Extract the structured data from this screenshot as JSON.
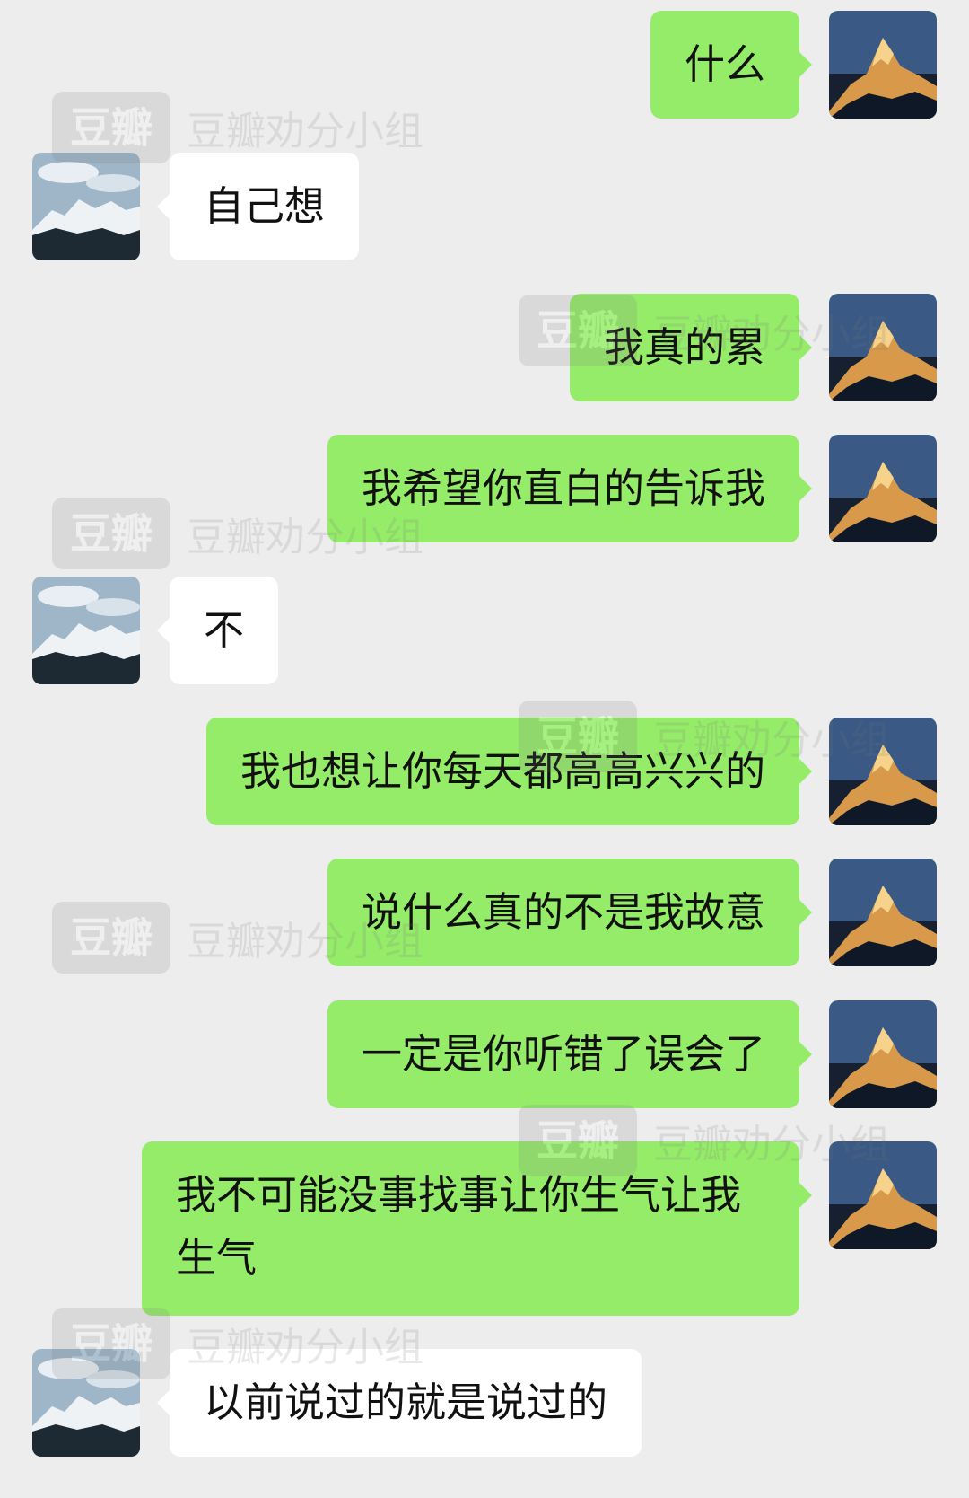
{
  "messages": [
    {
      "side": "me",
      "text": "什么"
    },
    {
      "side": "other",
      "text": "自己想"
    },
    {
      "side": "me",
      "text": "我真的累"
    },
    {
      "side": "me",
      "text": "我希望你直白的告诉我"
    },
    {
      "side": "other",
      "text": "不"
    },
    {
      "side": "me",
      "text": "我也想让你每天都高高兴兴的"
    },
    {
      "side": "me",
      "text": "说什么真的不是我故意"
    },
    {
      "side": "me",
      "text": "一定是你听错了误会了"
    },
    {
      "side": "me",
      "text": "我不可能没事找事让你生气让我生气"
    },
    {
      "side": "other",
      "text": "以前说过的就是说过的"
    }
  ],
  "watermark": {
    "logo": "豆瓣",
    "text": "豆瓣劝分小组"
  },
  "colors": {
    "background": "#ededed",
    "my_bubble": "#95ec69",
    "their_bubble": "#ffffff"
  },
  "icons": {
    "my_avatar": "sunlit-mountain-avatar",
    "their_avatar": "snowy-mountain-avatar"
  }
}
